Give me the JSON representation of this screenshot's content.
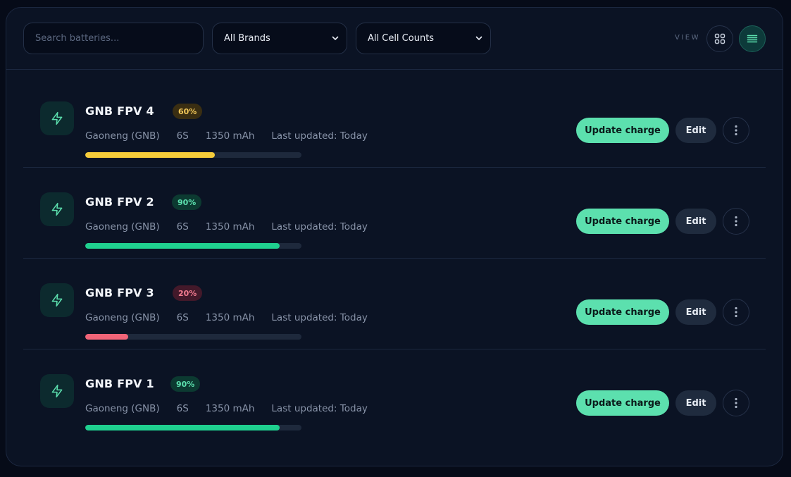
{
  "toolbar": {
    "search_placeholder": "Search batteries...",
    "brand_filter": "All Brands",
    "cell_filter": "All Cell Counts",
    "view_label": "VIEW",
    "view_modes": [
      "grid-icon",
      "list-icon"
    ],
    "active_view": "list"
  },
  "colors": {
    "accent": "#5ce0ae",
    "bar_green": "#1fd08f",
    "bar_yellow": "#f6cc3a",
    "bar_red": "#f06478"
  },
  "batteries": [
    {
      "name": "GNB FPV 4",
      "percent_label": "60%",
      "charge": 0.6,
      "status": "medium",
      "brand": "Gaoneng (GNB)",
      "cells": "6S",
      "capacity": "1350 mAh",
      "updated": "Last updated: Today",
      "update_label": "Update charge",
      "edit_label": "Edit"
    },
    {
      "name": "GNB FPV 2",
      "percent_label": "90%",
      "charge": 0.9,
      "status": "high",
      "brand": "Gaoneng (GNB)",
      "cells": "6S",
      "capacity": "1350 mAh",
      "updated": "Last updated: Today",
      "update_label": "Update charge",
      "edit_label": "Edit"
    },
    {
      "name": "GNB FPV 3",
      "percent_label": "20%",
      "charge": 0.2,
      "status": "low",
      "brand": "Gaoneng (GNB)",
      "cells": "6S",
      "capacity": "1350 mAh",
      "updated": "Last updated: Today",
      "update_label": "Update charge",
      "edit_label": "Edit"
    },
    {
      "name": "GNB FPV 1",
      "percent_label": "90%",
      "charge": 0.9,
      "status": "high",
      "brand": "Gaoneng (GNB)",
      "cells": "6S",
      "capacity": "1350 mAh",
      "updated": "Last updated: Today",
      "update_label": "Update charge",
      "edit_label": "Edit"
    }
  ]
}
